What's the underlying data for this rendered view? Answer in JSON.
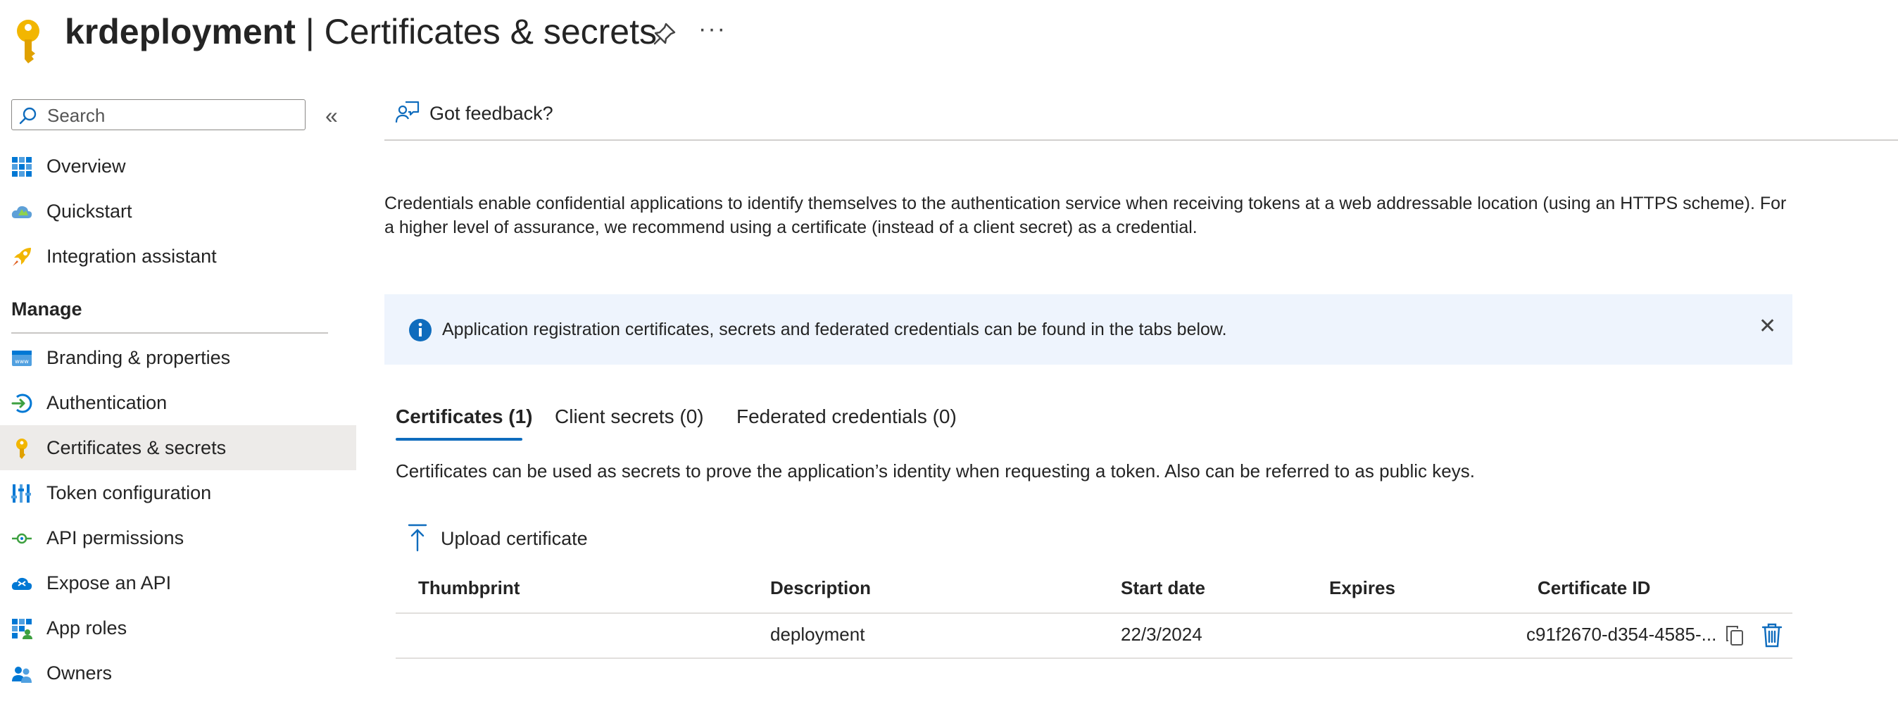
{
  "header": {
    "app_name": "krdeployment",
    "separator": " | ",
    "page_title": "Certificates & secrets",
    "more_label": "···",
    "icons": {
      "app": "key-icon",
      "pin": "pin-icon",
      "more": "ellipsis-icon"
    }
  },
  "sidebar": {
    "search_placeholder": "Search",
    "collapse_label": "«",
    "items_top": [
      {
        "label": "Overview",
        "icon": "overview-grid-icon"
      },
      {
        "label": "Quickstart",
        "icon": "cloud-icon"
      },
      {
        "label": "Integration assistant",
        "icon": "rocket-icon"
      }
    ],
    "section_label": "Manage",
    "items_manage": [
      {
        "label": "Branding & properties",
        "icon": "branding-icon"
      },
      {
        "label": "Authentication",
        "icon": "authentication-icon"
      },
      {
        "label": "Certificates & secrets",
        "icon": "key-icon",
        "selected": true
      },
      {
        "label": "Token configuration",
        "icon": "token-bars-icon"
      },
      {
        "label": "API permissions",
        "icon": "api-permissions-icon"
      },
      {
        "label": "Expose an API",
        "icon": "cloud-api-icon"
      },
      {
        "label": "App roles",
        "icon": "app-roles-icon"
      },
      {
        "label": "Owners",
        "icon": "owners-icon"
      }
    ]
  },
  "main": {
    "feedback_label": "Got feedback?",
    "description": "Credentials enable confidential applications to identify themselves to the authentication service when receiving tokens at a web addressable location (using an HTTPS scheme). For a higher level of assurance, we recommend using a certificate (instead of a client secret) as a credential.",
    "banner": {
      "text": "Application registration certificates, secrets and federated credentials can be found in the tabs below.",
      "close_label": "✕"
    },
    "tabs": [
      {
        "label": "Certificates (1)",
        "active": true
      },
      {
        "label": "Client secrets (0)",
        "active": false
      },
      {
        "label": "Federated credentials (0)",
        "active": false
      }
    ],
    "tab_description": "Certificates can be used as secrets to prove the application’s identity when requesting a token. Also can be referred to as public keys.",
    "upload_label": "Upload certificate",
    "table": {
      "headers": [
        "Thumbprint",
        "Description",
        "Start date",
        "Expires",
        "Certificate ID"
      ],
      "rows": [
        {
          "thumbprint": "",
          "description": "deployment",
          "start_date": "22/3/2024",
          "expires": "",
          "certificate_id": "c91f2670-d354-4585-..."
        }
      ]
    }
  },
  "colors": {
    "accent": "#0f6cbd",
    "key_gold": "#f2b600",
    "banner_bg": "#eef4fd",
    "selected_bg": "#edebe9"
  }
}
